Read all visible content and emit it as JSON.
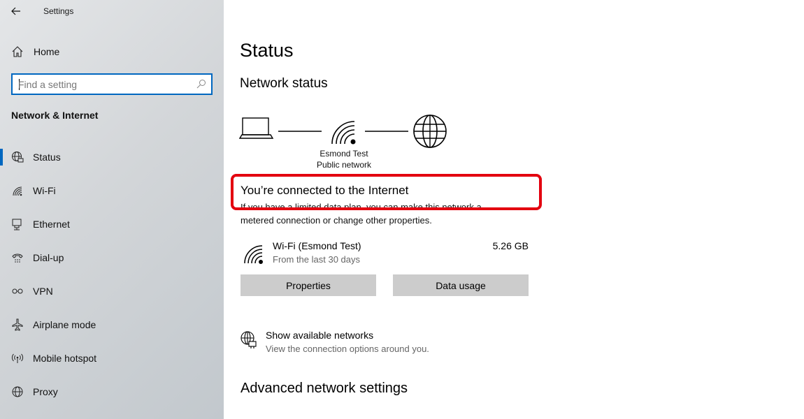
{
  "window": {
    "title": "Settings"
  },
  "sidebar": {
    "home_label": "Home",
    "search": {
      "placeholder": "Find a setting",
      "value": ""
    },
    "section_title": "Network & Internet",
    "items": [
      {
        "label": "Status",
        "icon": "globe-network-icon",
        "active": true
      },
      {
        "label": "Wi-Fi",
        "icon": "wifi-icon",
        "active": false
      },
      {
        "label": "Ethernet",
        "icon": "ethernet-icon",
        "active": false
      },
      {
        "label": "Dial-up",
        "icon": "dialup-icon",
        "active": false
      },
      {
        "label": "VPN",
        "icon": "vpn-icon",
        "active": false
      },
      {
        "label": "Airplane mode",
        "icon": "airplane-icon",
        "active": false
      },
      {
        "label": "Mobile hotspot",
        "icon": "hotspot-icon",
        "active": false
      },
      {
        "label": "Proxy",
        "icon": "globe-icon",
        "active": false
      }
    ]
  },
  "main": {
    "page_title": "Status",
    "network_status_heading": "Network status",
    "diagram": {
      "network_name": "Esmond Test",
      "network_type": "Public network"
    },
    "connected_text": "You’re connected to the Internet",
    "description_line1": "If you have a limited data plan, you can make this network a",
    "description_line2": "metered connection or change other properties.",
    "connection": {
      "name": "Wi-Fi (Esmond Test)",
      "period": "From the last 30 days",
      "usage": "5.26 GB"
    },
    "buttons": {
      "properties": "Properties",
      "data_usage": "Data usage"
    },
    "available": {
      "title": "Show available networks",
      "subtitle": "View the connection options around you."
    },
    "advanced_heading": "Advanced network settings"
  },
  "colors": {
    "accent": "#0067c0",
    "highlight": "#e3000f",
    "button_bg": "#cccccc"
  }
}
